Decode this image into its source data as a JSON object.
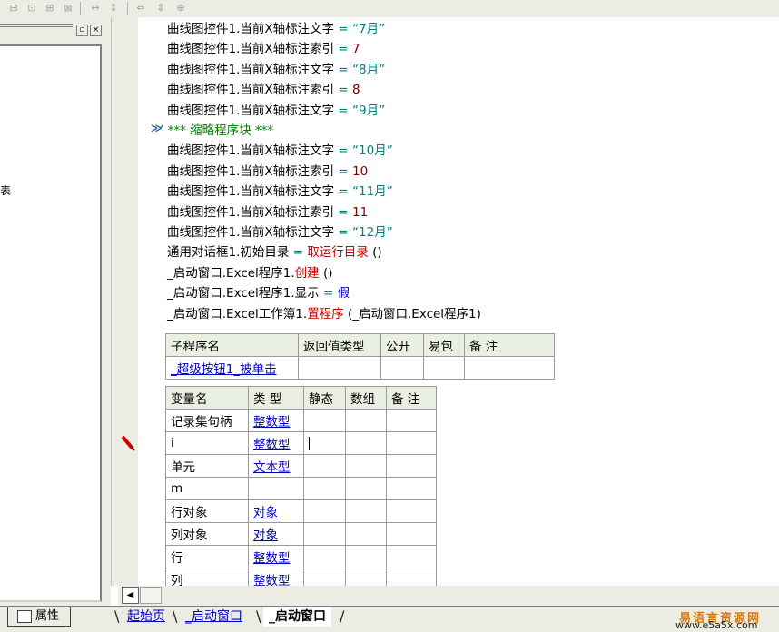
{
  "code_lines": [
    {
      "obj": "曲线图控件1.当前X轴标注文字",
      "eq": " = ",
      "val": "“7月”",
      "type": "str"
    },
    {
      "obj": "曲线图控件1.当前X轴标注索引",
      "eq": " = ",
      "val": "7",
      "type": "num"
    },
    {
      "obj": "曲线图控件1.当前X轴标注文字",
      "eq": " = ",
      "val": "“8月”",
      "type": "str"
    },
    {
      "obj": "曲线图控件1.当前X轴标注索引",
      "eq": " = ",
      "val": "8",
      "type": "num"
    },
    {
      "obj": "曲线图控件1.当前X轴标注文字",
      "eq": " = ",
      "val": "“9月”",
      "type": "str"
    },
    {
      "comment": "’ *** 缩略程序块 ***",
      "type": "comment"
    },
    {
      "obj": "曲线图控件1.当前X轴标注文字",
      "eq": " = ",
      "val": "“10月”",
      "type": "str"
    },
    {
      "obj": "曲线图控件1.当前X轴标注索引",
      "eq": " = ",
      "val": "10",
      "type": "num"
    },
    {
      "obj": "曲线图控件1.当前X轴标注文字",
      "eq": " = ",
      "val": "“11月”",
      "type": "str"
    },
    {
      "obj": "曲线图控件1.当前X轴标注索引",
      "eq": " = ",
      "val": "11",
      "type": "num"
    },
    {
      "obj": "曲线图控件1.当前X轴标注文字",
      "eq": " = ",
      "val": "“12月”",
      "type": "str"
    },
    {
      "obj": "通用对话框1.初始目录",
      "eq": " = ",
      "fn": "取运行目录",
      "args": " ()",
      "type": "fn"
    },
    {
      "obj": "_启动窗口.Excel程序1.",
      "fn": "创建",
      "args": " ()",
      "type": "call"
    },
    {
      "obj": "_启动窗口.Excel程序1.显示",
      "eq": " = ",
      "val": "假",
      "type": "kw"
    },
    {
      "obj": "_启动窗口.Excel工作簿1.",
      "fn": "置程序",
      "args": " (_启动窗口.Excel程序1)",
      "type": "call"
    }
  ],
  "sub_table": {
    "headers": [
      "子程序名",
      "返回值类型",
      "公开",
      "易包",
      "备 注"
    ],
    "row": [
      "_超级按钮1_被单击",
      "",
      "",
      "",
      ""
    ]
  },
  "var_table": {
    "headers": [
      "变量名",
      "类 型",
      "静态",
      "数组",
      "备 注"
    ],
    "rows": [
      [
        "记录集句柄",
        "整数型"
      ],
      [
        "i",
        "整数型"
      ],
      [
        "单元",
        "文本型"
      ],
      [
        "m",
        ""
      ],
      [
        "行对象",
        "对象"
      ],
      [
        "列对象",
        "对象"
      ],
      [
        "行",
        "整数型"
      ],
      [
        "列",
        "整数型"
      ]
    ]
  },
  "left_panel": {
    "mark": "表",
    "prop_tab": "属性"
  },
  "tabs": [
    "起始页",
    "_启动窗口",
    "_启动窗口"
  ],
  "watermark": {
    "line1": "易语言资源网",
    "line2": "www.e5a5x.com"
  },
  "colors": {
    "string": "#008080",
    "number": "#800000",
    "function": "#cc0000",
    "keyword": "#0000c0",
    "comment": "#008000"
  }
}
